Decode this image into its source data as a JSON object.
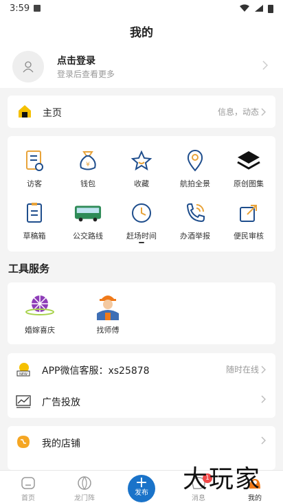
{
  "status_bar": {
    "time": "3:59"
  },
  "header": {
    "title": "我的"
  },
  "profile": {
    "title": "点击登录",
    "subtitle": "登录后查看更多"
  },
  "home_row": {
    "label": "主页",
    "right_text": "信息，动态"
  },
  "grid": [
    {
      "label": "访客",
      "icon": "visitor-icon"
    },
    {
      "label": "钱包",
      "icon": "wallet-icon"
    },
    {
      "label": "收藏",
      "icon": "star-icon"
    },
    {
      "label": "航拍全景",
      "icon": "location-pin-icon"
    },
    {
      "label": "原创图集",
      "icon": "layers-icon"
    },
    {
      "label": "草稿箱",
      "icon": "draft-icon"
    },
    {
      "label": "公交路线",
      "icon": "bus-icon"
    },
    {
      "label": "赶场时间",
      "icon": "clock-icon"
    },
    {
      "label": "办酒举报",
      "icon": "phone-report-icon"
    },
    {
      "label": "便民审核",
      "icon": "share-review-icon"
    }
  ],
  "tools_section": {
    "title": "工具服务"
  },
  "tools": [
    {
      "label": "婚嫁喜庆",
      "icon": "wedding-icon"
    },
    {
      "label": "找师傅",
      "icon": "worker-icon"
    }
  ],
  "list": [
    {
      "label": "APP微信客服：xs25878",
      "right_text": "随时在线",
      "icon": "customer-service-icon"
    },
    {
      "label": "广告投放",
      "right_text": "",
      "icon": "ad-chart-icon"
    }
  ],
  "shop": {
    "label": "我的店铺",
    "icon": "shop-icon"
  },
  "tab_bar": {
    "tabs": [
      {
        "label": "首页",
        "icon": "home-tab-icon"
      },
      {
        "label": "龙门阵",
        "icon": "forum-tab-icon"
      },
      {
        "label": "发布",
        "icon": "plus-icon"
      },
      {
        "label": "消息",
        "icon": "message-tab-icon"
      },
      {
        "label": "我的",
        "icon": "me-tab-icon"
      }
    ],
    "message_badge": "1"
  },
  "watermark": "大玩家",
  "colors": {
    "accent": "#e8a33a",
    "blue": "#1a73c9",
    "badge": "#f04848"
  }
}
